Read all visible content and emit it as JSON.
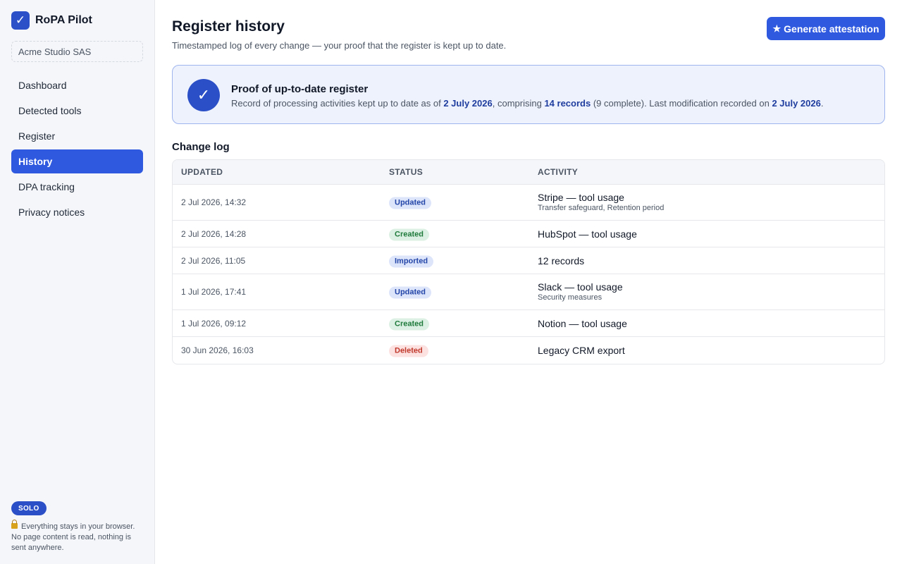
{
  "app": {
    "name": "RoPA Pilot",
    "logo_glyph": "✓",
    "workspace": "Acme Studio SAS"
  },
  "sidebar": {
    "items": [
      {
        "label": "Dashboard",
        "active": false
      },
      {
        "label": "Detected tools",
        "active": false
      },
      {
        "label": "Register",
        "active": false
      },
      {
        "label": "History",
        "active": true
      },
      {
        "label": "DPA tracking",
        "active": false
      },
      {
        "label": "Privacy notices",
        "active": false
      }
    ],
    "plan_badge": "SOLO",
    "privacy_note": "Everything stays in your browser. No page content is read, nothing is sent anywhere."
  },
  "header": {
    "title": "Register history",
    "subtitle": "Timestamped log of every change — your proof that the register is kept up to date.",
    "action_label": "Generate attestation",
    "action_icon": "star-icon"
  },
  "proof": {
    "title": "Proof of up-to-date register",
    "text_prefix": "Record of processing activities kept up to date as of ",
    "as_of_date": "2 July 2026",
    "text_mid": ", comprising ",
    "records": "14 records",
    "text_mid2": " (9 complete). Last modification recorded on ",
    "last_modified": "2 July 2026",
    "text_suffix": "."
  },
  "change_log": {
    "title": "Change log",
    "columns": {
      "updated": "UPDATED",
      "status": "STATUS",
      "activity": "ACTIVITY"
    },
    "rows": [
      {
        "updated": "2 Jul 2026, 14:32",
        "status": "Updated",
        "status_kind": "updated",
        "activity": "Stripe — tool usage",
        "detail": "Transfer safeguard, Retention period"
      },
      {
        "updated": "2 Jul 2026, 14:28",
        "status": "Created",
        "status_kind": "created",
        "activity": "HubSpot — tool usage",
        "detail": ""
      },
      {
        "updated": "2 Jul 2026, 11:05",
        "status": "Imported",
        "status_kind": "imported",
        "activity": "12 records",
        "detail": ""
      },
      {
        "updated": "1 Jul 2026, 17:41",
        "status": "Updated",
        "status_kind": "updated",
        "activity": "Slack — tool usage",
        "detail": "Security measures"
      },
      {
        "updated": "1 Jul 2026, 09:12",
        "status": "Created",
        "status_kind": "created",
        "activity": "Notion — tool usage",
        "detail": ""
      },
      {
        "updated": "30 Jun 2026, 16:03",
        "status": "Deleted",
        "status_kind": "deleted",
        "activity": "Legacy CRM export",
        "detail": ""
      }
    ]
  },
  "colors": {
    "accent": "#2f5ae0",
    "brand": "#2b4fc6",
    "created": "#1f7a3c",
    "deleted": "#c0392b"
  }
}
